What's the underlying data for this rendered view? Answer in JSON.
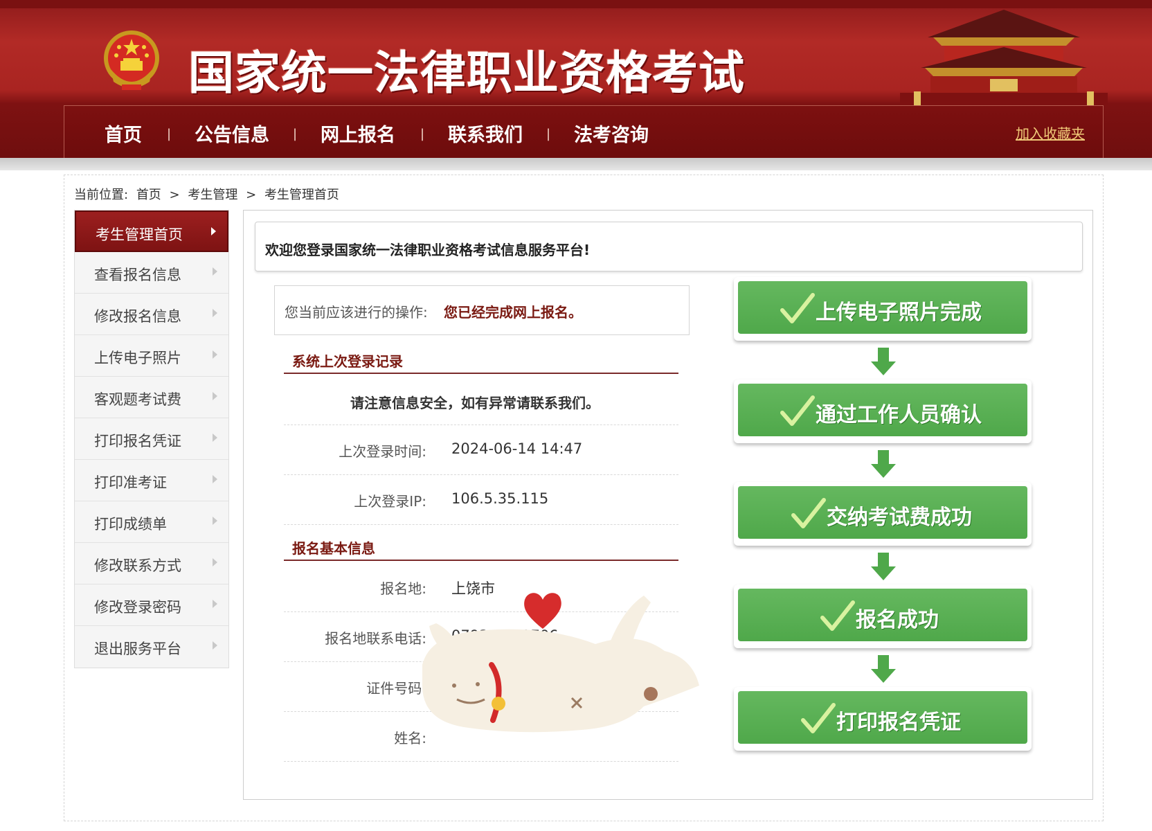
{
  "site": {
    "title": "国家统一法律职业资格考试",
    "colors": {
      "brand_red": "#a92421",
      "nav_red": "#7d1010",
      "step_green": "#56ad50",
      "accent_text": "#7a1a12",
      "fav_link": "#f0c978"
    }
  },
  "nav": {
    "items": [
      "首页",
      "公告信息",
      "网上报名",
      "联系我们",
      "法考咨询"
    ],
    "separator": "|",
    "favorite_label": "加入收藏夹"
  },
  "breadcrumb": {
    "prefix": "当前位置:",
    "items": [
      "首页",
      "考生管理",
      "考生管理首页"
    ],
    "sep": ">"
  },
  "sidebar": {
    "items": [
      {
        "label": "考生管理首页",
        "active": true
      },
      {
        "label": "查看报名信息"
      },
      {
        "label": "修改报名信息"
      },
      {
        "label": "上传电子照片"
      },
      {
        "label": "客观题考试费"
      },
      {
        "label": "打印报名凭证"
      },
      {
        "label": "打印准考证"
      },
      {
        "label": "打印成绩单"
      },
      {
        "label": "修改联系方式"
      },
      {
        "label": "修改登录密码"
      },
      {
        "label": "退出服务平台"
      }
    ]
  },
  "main": {
    "welcome": "欢迎您登录国家统一法律职业资格考试信息服务平台!",
    "action": {
      "label": "您当前应该进行的操作:",
      "value": "您已经完成网上报名。"
    },
    "login_section": {
      "title": "系统上次登录记录",
      "notice": "请注意信息安全，如有异常请联系我们。",
      "rows": [
        {
          "key": "上次登录时间:",
          "value": "2024-06-14 14:47"
        },
        {
          "key": "上次登录IP:",
          "value": "106.5.35.115"
        }
      ]
    },
    "basic_section": {
      "title": "报名基本信息",
      "rows": [
        {
          "key": "报名地:",
          "value": "上饶市"
        },
        {
          "key": "报名地联系电话:",
          "value": "0793-8250706"
        },
        {
          "key": "证件号码:",
          "value": ""
        },
        {
          "key": "姓名:",
          "value": ""
        }
      ]
    },
    "steps": [
      "上传电子照片完成",
      "通过工作人员确认",
      "交纳考试费成功",
      "报名成功",
      "打印报名凭证"
    ]
  }
}
